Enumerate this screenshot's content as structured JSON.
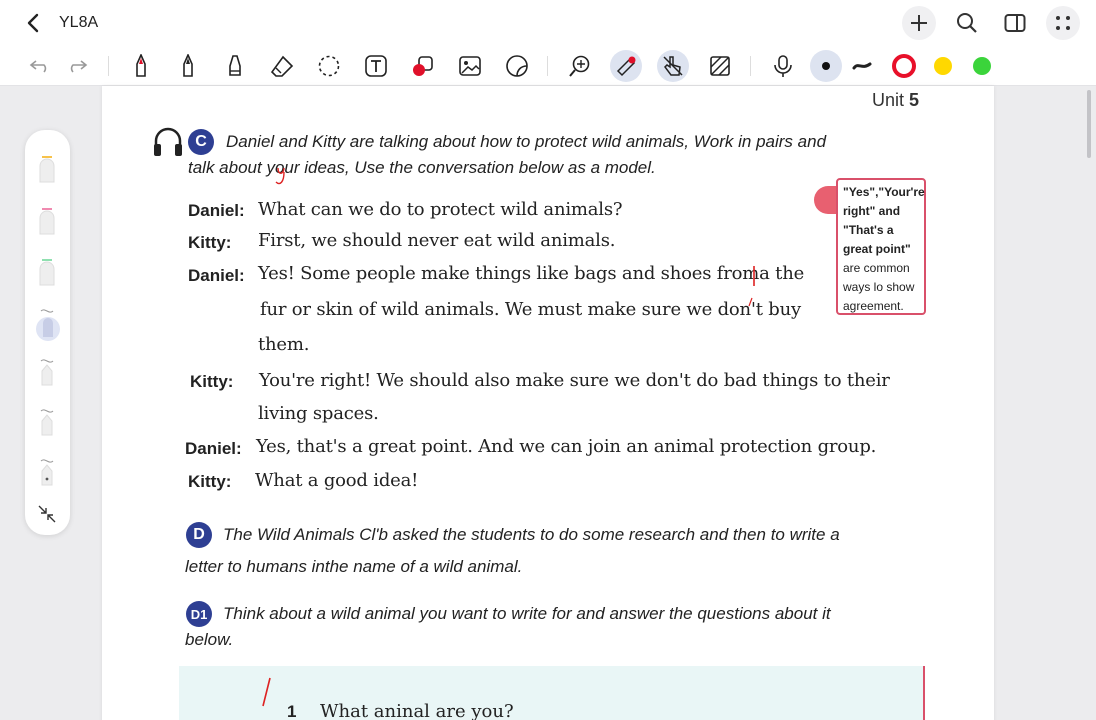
{
  "app": {
    "title": "YL8A",
    "icons": [
      "back-arrow-icon",
      "plus-icon",
      "search-icon",
      "sidebar-panel-icon",
      "more-grid-icon"
    ]
  },
  "toolbar": {
    "tools": [
      "undo-icon",
      "redo-icon",
      "pen-icon",
      "fountain-pen-icon",
      "highlighter-icon",
      "eraser-icon",
      "lasso-icon",
      "text-icon",
      "shape-icon",
      "image-icon",
      "sticker-icon",
      "zoom-icon",
      "laser-pointer-icon",
      "touch-pen-icon",
      "pattern-icon",
      "microphone-icon",
      "thin-stroke-icon",
      "brush-stroke-icon"
    ],
    "colors": [
      "#e8102a",
      "#ffd800",
      "#3bd43b"
    ]
  },
  "page": {
    "unit_label": "Unit",
    "unit_num": "5",
    "section_c": {
      "letter": "C",
      "line1": "Daniel and Kitty are talking about how to protect wild animals, Work in pairs and",
      "line2": "talk about your ideas, Use the conversation below as a model."
    },
    "dialogue": [
      {
        "speaker": "Daniel:",
        "lines": [
          "What can we do to protect wild animals?"
        ]
      },
      {
        "speaker": "Kitty:",
        "lines": [
          "First, we should never eat wild animals."
        ]
      },
      {
        "speaker": "Daniel:",
        "lines": [
          "Yes! Some people make things like bags and shoes froma the",
          "fur or skin of wild animals. We must make sure we don't buy",
          "them."
        ]
      },
      {
        "speaker": "Kitty:",
        "lines": [
          "You're right! We should also make sure we don't do bad things to their",
          "living spaces."
        ]
      },
      {
        "speaker": "Daniel:",
        "lines": [
          "Yes, that's a great point. And we can join an animal protection group."
        ]
      },
      {
        "speaker": "Kitty:",
        "lines": [
          "What a good idea!"
        ]
      }
    ],
    "note": {
      "l1": "\"Yes\",\"Your're",
      "l2": "right\" and",
      "l3": "\"That's a",
      "l4": "great point\"",
      "l5": "are common",
      "l6": "ways lo show",
      "l7": "agreement."
    },
    "section_d": {
      "letter": "D",
      "line1": "The Wild Animals Cl'b asked the students to do some research and then to write a",
      "line2": "letter to humans inthe name of a wild animal."
    },
    "section_d1": {
      "letter": "D1",
      "line1": "Think about a wild animal you want to write for and answer the questions about it",
      "line2": "below."
    },
    "question": {
      "num": "1",
      "text": "What aninal are you?"
    }
  },
  "palette": {
    "pens": [
      "#f7c24a",
      "#f08ab0",
      "#8fe0b0",
      "#9aa8d8",
      "#cccccc",
      "#cccccc",
      "#cccccc"
    ]
  }
}
